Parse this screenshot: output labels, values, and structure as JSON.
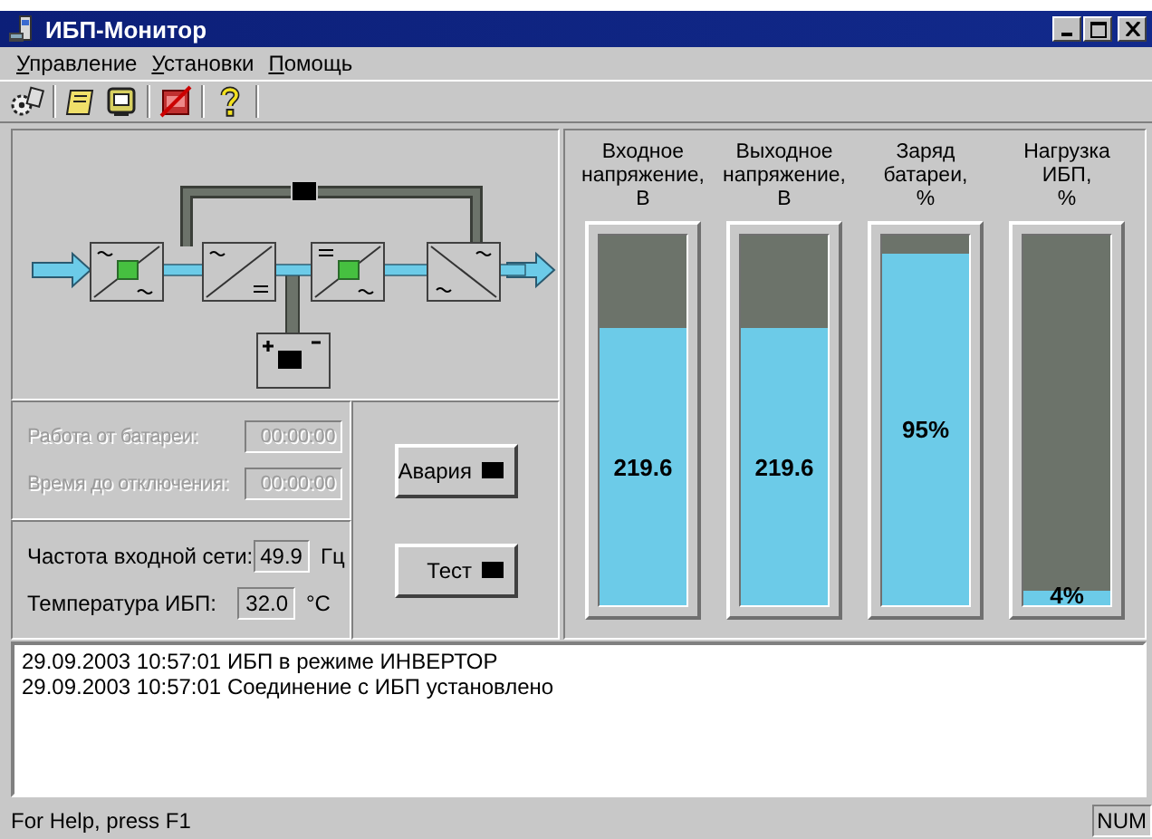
{
  "window": {
    "title": "ИБП-Монитор"
  },
  "menu": [
    {
      "key": "У",
      "rest": "правление"
    },
    {
      "key": "У",
      "rest": "становки"
    },
    {
      "key": "П",
      "rest": "омощь"
    }
  ],
  "toolbar": [
    {
      "kind": "gears"
    },
    {
      "kind": "note"
    },
    {
      "kind": "monitor"
    },
    {
      "kind": "test-off"
    },
    {
      "kind": "help"
    }
  ],
  "battery_times": [
    {
      "label": "Работа от батареи:",
      "value": "00:00:00",
      "disabled": true
    },
    {
      "label": "Время до отключения:",
      "value": "00:00:00",
      "disabled": true
    }
  ],
  "readings": [
    {
      "label": "Частота входной сети:",
      "value": "49.9",
      "unit": "Гц"
    },
    {
      "label": "Температура ИБП:",
      "value": "32.0",
      "unit": "°С"
    }
  ],
  "buttons": [
    {
      "label": "Авария"
    },
    {
      "label": "Тест"
    }
  ],
  "meters": [
    {
      "title": [
        "Входное",
        "напряжение,",
        "В"
      ],
      "value": "219.6",
      "level": 0.75
    },
    {
      "title": [
        "Выходное",
        "напряжение,",
        "В"
      ],
      "value": "219.6",
      "level": 0.75
    },
    {
      "title": [
        "Заряд",
        "батареи,",
        "%"
      ],
      "value": "95%",
      "level": 0.95
    },
    {
      "title": [
        "Нагрузка",
        "ИБП,",
        "%"
      ],
      "value": "4%",
      "level": 0.04
    }
  ],
  "log": [
    "29.09.2003 10:57:01 ИБП в режиме ИНВЕРТОР",
    "29.09.2003 10:57:01 Соединение с ИБП установлено"
  ],
  "status_bar": {
    "text": "For Help, press F1",
    "indicators": [
      "NUM"
    ]
  }
}
